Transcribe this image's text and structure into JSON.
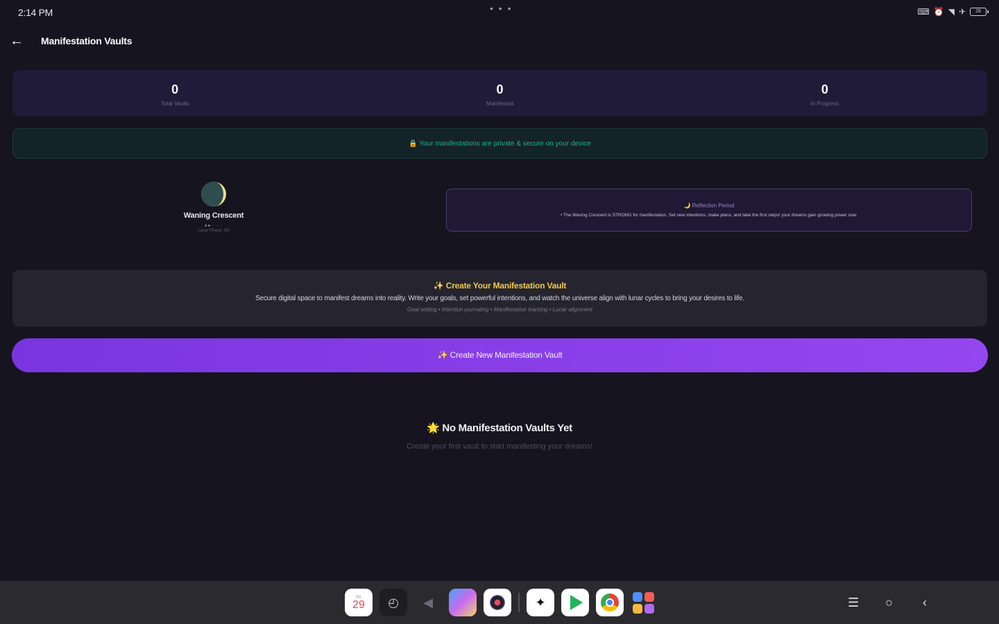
{
  "status_bar": {
    "time": "2:14 PM",
    "center_dots": "• • •",
    "icons": [
      "keyboard-icon",
      "alarm-icon",
      "wifi-icon",
      "airplane-icon",
      "battery-icon"
    ],
    "battery_label": "28"
  },
  "header": {
    "back_icon": "arrow-left-icon",
    "title": "Manifestation Vaults"
  },
  "stats": [
    {
      "value": "0",
      "label": "Total Vaults"
    },
    {
      "value": "0",
      "label": "Manifested"
    },
    {
      "value": "0",
      "label": "In Progress"
    }
  ],
  "privacy": {
    "icon": "lock-icon",
    "text": "Your manifestations are private & secure on your device"
  },
  "moon": {
    "icon": "waning-crescent-moon-icon",
    "name": "Waning Crescent",
    "dots": "●● · · ·",
    "sub": "Lunar Phase: 3/5"
  },
  "reflection": {
    "title": "🌙 Reflection Period",
    "text": "• The Waxing Crescent is STRONG for manifestation. Set new intentions, make plans, and take the first steps! your dreams gain growing power now."
  },
  "info_card": {
    "title": "✨ Create Your Manifestation Vault",
    "description": "Secure digital space to manifest dreams into reality. Write your goals, set powerful intentions, and watch the universe align with lunar cycles to bring your desires to life.",
    "tags": "Goal setting • Intention journaling • Manifestation tracking • Lunar alignment"
  },
  "create_button": {
    "label": "✨ Create New Manifestation Vault"
  },
  "empty_state": {
    "title": "🌟 No Manifestation Vaults Yet",
    "subtitle": "Create your first vault to start manifesting your dreams!"
  },
  "taskbar": {
    "calendar_day": "Fri",
    "calendar_date": "29",
    "apps": [
      "calendar",
      "clock",
      "navigation",
      "gallery",
      "camera",
      "ai-assistant",
      "play-store",
      "chrome",
      "app-drawer"
    ],
    "nav_buttons": [
      "recents",
      "home",
      "back"
    ]
  },
  "colors": {
    "background": "#16141f",
    "accent_purple": "#8a3fe8",
    "privacy_green": "#1fb38a",
    "info_gold": "#f2c94c"
  }
}
